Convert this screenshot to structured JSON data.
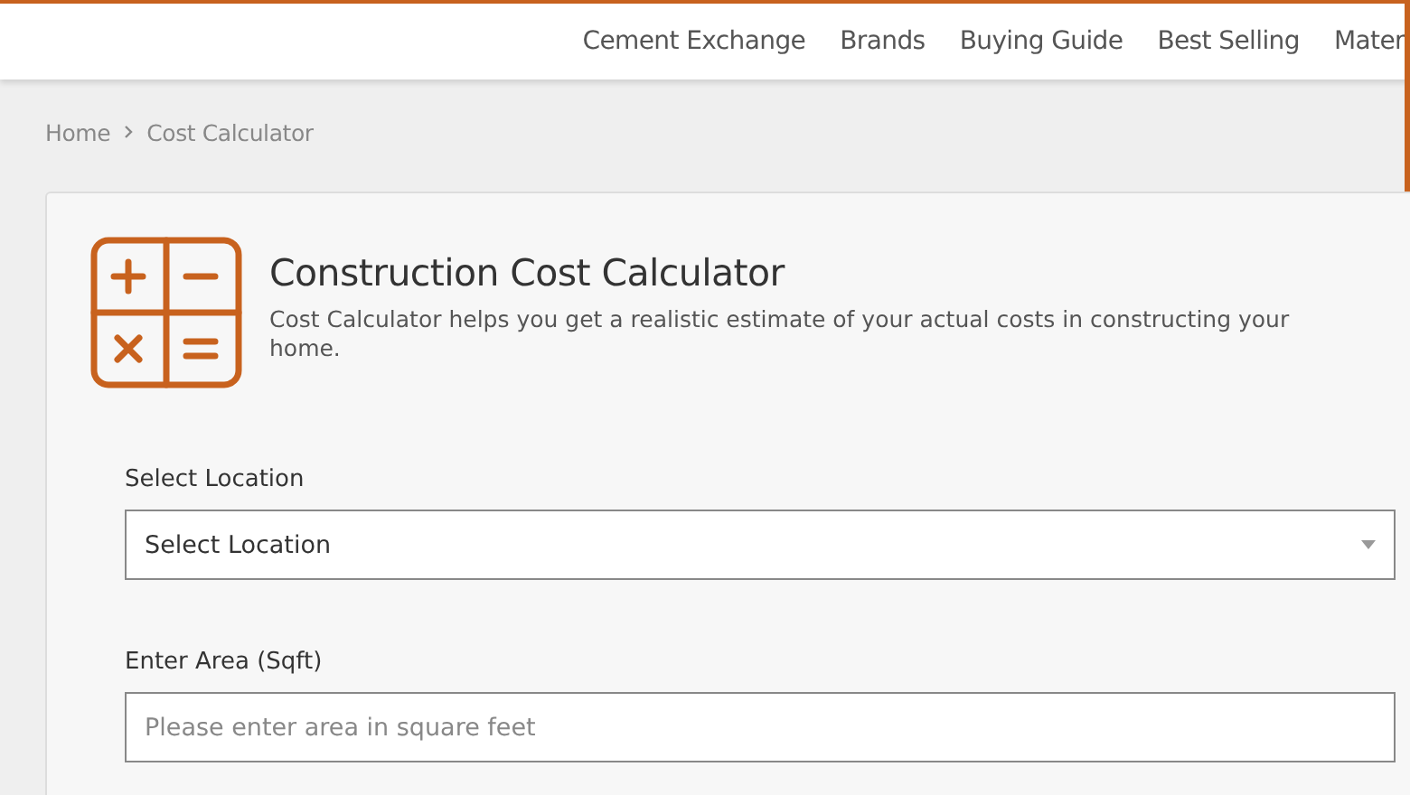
{
  "nav": {
    "items": [
      "Cement Exchange",
      "Brands",
      "Buying Guide",
      "Best Selling",
      "Mater"
    ]
  },
  "breadcrumb": [
    "Home",
    "Cost Calculator"
  ],
  "calculator": {
    "title": "Construction Cost Calculator",
    "description": "Cost Calculator helps you get a realistic estimate of your actual costs in constructing your home.",
    "fields": [
      {
        "kind": "select",
        "label": "Select Location",
        "value": "Select Location"
      },
      {
        "kind": "input",
        "label": "Enter Area (Sqft)",
        "placeholder": "Please enter area in square feet"
      }
    ]
  }
}
